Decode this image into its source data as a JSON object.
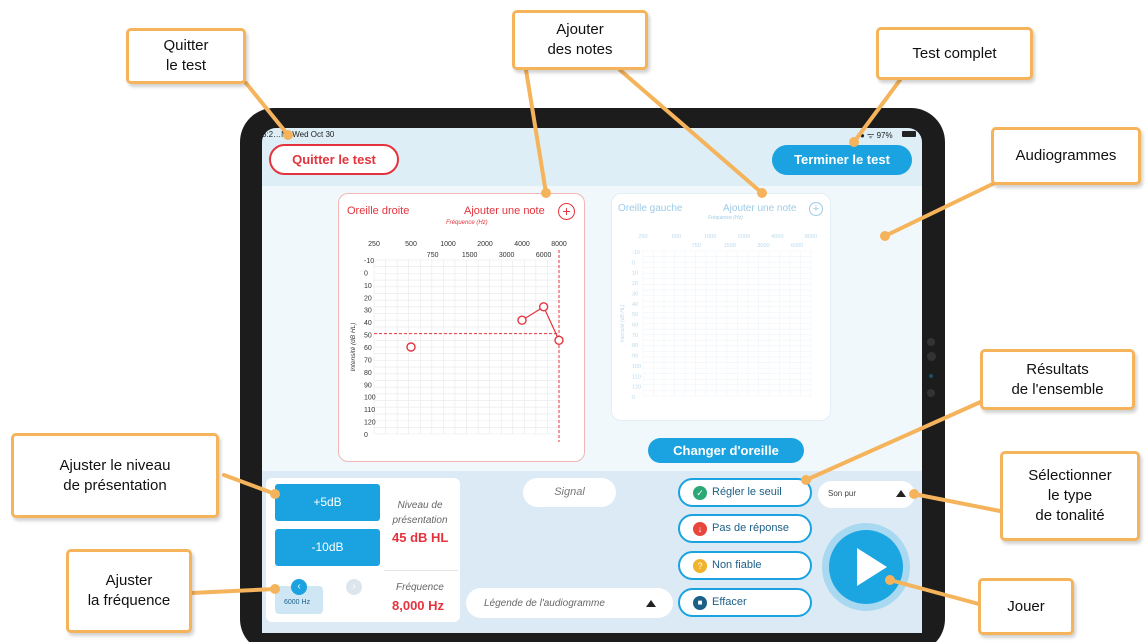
{
  "status_bar": {
    "time": "3:2…M",
    "date": "Wed Oct 30",
    "battery": "97%"
  },
  "header": {
    "quit_label": "Quitter le test",
    "finish_label": "Terminer le test"
  },
  "right_ear": {
    "title": "Oreille droite",
    "add_note_label": "Ajouter une note",
    "x_axis_label": "Fréquence (Hz)",
    "y_axis_label": "Intensité (dB HL)",
    "freq_top": [
      "250",
      "500",
      "1000",
      "2000",
      "4000",
      "8000"
    ],
    "freq_bottom": [
      "750",
      "1500",
      "3000",
      "6000"
    ],
    "db_labels": [
      "-10",
      "0",
      "10",
      "20",
      "30",
      "40",
      "50",
      "60",
      "70",
      "80",
      "90",
      "100",
      "110",
      "120",
      "0"
    ],
    "thresholds": [
      {
        "freq": 500,
        "db": 55
      },
      {
        "freq": 4000,
        "db": 35
      },
      {
        "freq": 6000,
        "db": 25
      },
      {
        "freq": 8000,
        "db": 50
      }
    ],
    "current_level_db": 45,
    "current_freq_hz": 8000
  },
  "left_ear": {
    "title": "Oreille gauche",
    "add_note_label": "Ajouter une note",
    "x_axis_label": "Fréquence (Hz)",
    "y_axis_label": "Intensité (dB HL)",
    "freq_top": [
      "250",
      "500",
      "1000",
      "2000",
      "4000",
      "8000"
    ],
    "freq_bottom": [
      "750",
      "1500",
      "3000",
      "6000"
    ],
    "db_labels": [
      "-10",
      "0",
      "10",
      "20",
      "30",
      "40",
      "50",
      "60",
      "70",
      "80",
      "90",
      "100",
      "110",
      "120",
      "0"
    ]
  },
  "switch_ear_label": "Changer d'oreille",
  "controls": {
    "plus_label": "+5dB",
    "minus_label": "-10dB",
    "level_title": "Niveau de présentation",
    "level_value": "45 dB HL",
    "freq_title": "Fréquence",
    "freq_value": "8,000 Hz",
    "freq_button_label": "6000 Hz",
    "prev_glyph": "‹",
    "next_glyph": "›"
  },
  "signal_label": "Signal",
  "legend_label": "Légende de l'audiogramme",
  "actions": [
    {
      "label": "Régler le seuil",
      "icon": "check-icon",
      "glyph": "✓",
      "color": "#2aa876"
    },
    {
      "label": "Pas de réponse",
      "icon": "arrow-down-icon",
      "glyph": "↓",
      "color": "#e8453c"
    },
    {
      "label": "Non fiable",
      "icon": "question-icon",
      "glyph": "?",
      "color": "#f2b32c"
    },
    {
      "label": "Effacer",
      "icon": "trash-icon",
      "glyph": "🗑",
      "color": "#1c5f86"
    }
  ],
  "tone_select_value": "Son pur",
  "callouts": {
    "quit": [
      "Quitter",
      "le test"
    ],
    "notes": [
      "Ajouter",
      "des notes"
    ],
    "complete": [
      "Test complet"
    ],
    "audiograms": [
      "Audiogrammes"
    ],
    "results": [
      "Résultats",
      "de l'ensemble"
    ],
    "level": [
      "Ajuster le niveau",
      "de présentation"
    ],
    "tone": [
      "Sélectionner",
      "le type",
      "de tonalité"
    ],
    "freq": [
      "Ajuster",
      "la fréquence"
    ],
    "play": [
      "Jouer"
    ]
  },
  "colors": {
    "accent": "#1aa3e0",
    "red": "#e5333d",
    "callout_border": "#f5b35c"
  }
}
